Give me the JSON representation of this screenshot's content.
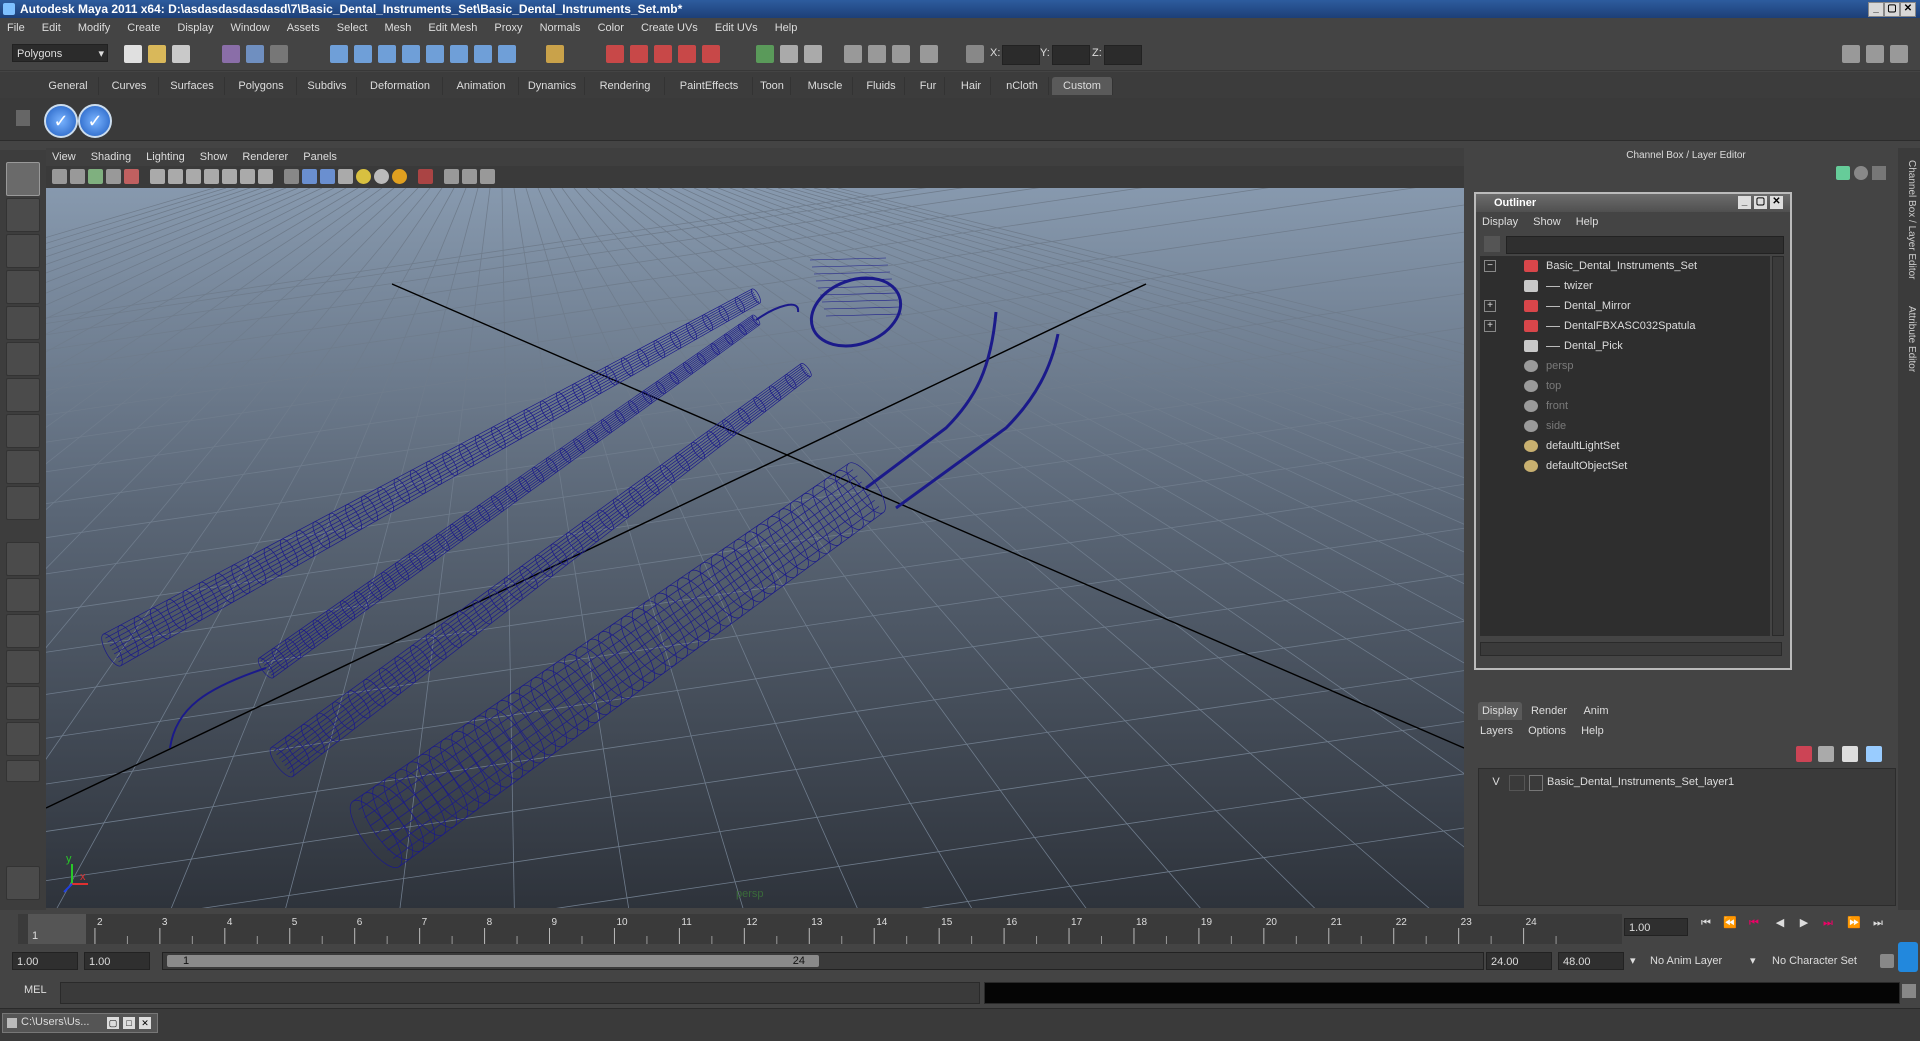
{
  "window": {
    "title": "Autodesk Maya 2011 x64: D:\\asdasdasdasdasd\\7\\Basic_Dental_Instruments_Set\\Basic_Dental_Instruments_Set.mb*"
  },
  "menubar": [
    "File",
    "Edit",
    "Modify",
    "Create",
    "Display",
    "Window",
    "Assets",
    "Select",
    "Mesh",
    "Edit Mesh",
    "Proxy",
    "Normals",
    "Color",
    "Create UVs",
    "Edit UVs",
    "Help"
  ],
  "statusline": {
    "mode": "Polygons",
    "x_label": "X:",
    "y_label": "Y:",
    "z_label": "Z:"
  },
  "shelf": {
    "tabs": [
      "General",
      "Curves",
      "Surfaces",
      "Polygons",
      "Subdivs",
      "Deformation",
      "Animation",
      "Dynamics",
      "Rendering",
      "PaintEffects",
      "Toon",
      "Muscle",
      "Fluids",
      "Fur",
      "Hair",
      "nCloth",
      "Custom"
    ],
    "active_tab": "Custom",
    "button_glyph": "✓"
  },
  "viewport": {
    "menu": [
      "View",
      "Shading",
      "Lighting",
      "Show",
      "Renderer",
      "Panels"
    ],
    "camera_label": "persp",
    "axis_x": "x",
    "axis_y": "y",
    "colors": {
      "wire": "#1b1a8a",
      "grid": "#6f7c8c",
      "axis": "#000000"
    }
  },
  "channel_box": {
    "title": "Channel Box / Layer Editor"
  },
  "side_tabs": [
    "Channel Box / Layer Editor",
    "Attribute Editor"
  ],
  "outliner": {
    "title": "Outliner",
    "menu": [
      "Display",
      "Show",
      "Help"
    ],
    "items": [
      {
        "label": "Basic_Dental_Instruments_Set",
        "indent": 0,
        "icon": "transform",
        "expander": "−",
        "dim": false
      },
      {
        "label": "twizer",
        "indent": 1,
        "icon": "mesh",
        "expander": "",
        "dim": false
      },
      {
        "label": "Dental_Mirror",
        "indent": 1,
        "icon": "transform",
        "expander": "+",
        "dim": false
      },
      {
        "label": "DentalFBXASC032Spatula",
        "indent": 1,
        "icon": "transform",
        "expander": "+",
        "dim": false
      },
      {
        "label": "Dental_Pick",
        "indent": 1,
        "icon": "mesh",
        "expander": "",
        "dim": false
      },
      {
        "label": "persp",
        "indent": 0,
        "icon": "camera",
        "expander": "",
        "dim": true
      },
      {
        "label": "top",
        "indent": 0,
        "icon": "camera",
        "expander": "",
        "dim": true
      },
      {
        "label": "front",
        "indent": 0,
        "icon": "camera",
        "expander": "",
        "dim": true
      },
      {
        "label": "side",
        "indent": 0,
        "icon": "camera",
        "expander": "",
        "dim": true
      },
      {
        "label": "defaultLightSet",
        "indent": 0,
        "icon": "set",
        "expander": "",
        "dim": false
      },
      {
        "label": "defaultObjectSet",
        "indent": 0,
        "icon": "set",
        "expander": "",
        "dim": false
      }
    ]
  },
  "layer_editor": {
    "tabs": [
      "Display",
      "Render",
      "Anim"
    ],
    "active_tab": "Display",
    "menu": [
      "Layers",
      "Options",
      "Help"
    ],
    "layers": [
      {
        "visible": "V",
        "name": "Basic_Dental_Instruments_Set_layer1"
      }
    ]
  },
  "timeline": {
    "ticks": [
      "1",
      "2",
      "3",
      "4",
      "5",
      "6",
      "7",
      "8",
      "9",
      "10",
      "11",
      "12",
      "13",
      "14",
      "15",
      "16",
      "17",
      "18",
      "19",
      "20",
      "21",
      "22",
      "23",
      "24"
    ],
    "current_marker": "1",
    "current_frame": "1.00"
  },
  "range": {
    "start": "1.00",
    "playback_start": "1.00",
    "slider_start": "1",
    "slider_end": "24",
    "playback_end": "24.00",
    "end": "48.00",
    "anim_layer": "No Anim Layer",
    "character_set": "No Character Set"
  },
  "command": {
    "label": "MEL"
  },
  "taskbar": {
    "label": "C:\\Users\\Us..."
  }
}
